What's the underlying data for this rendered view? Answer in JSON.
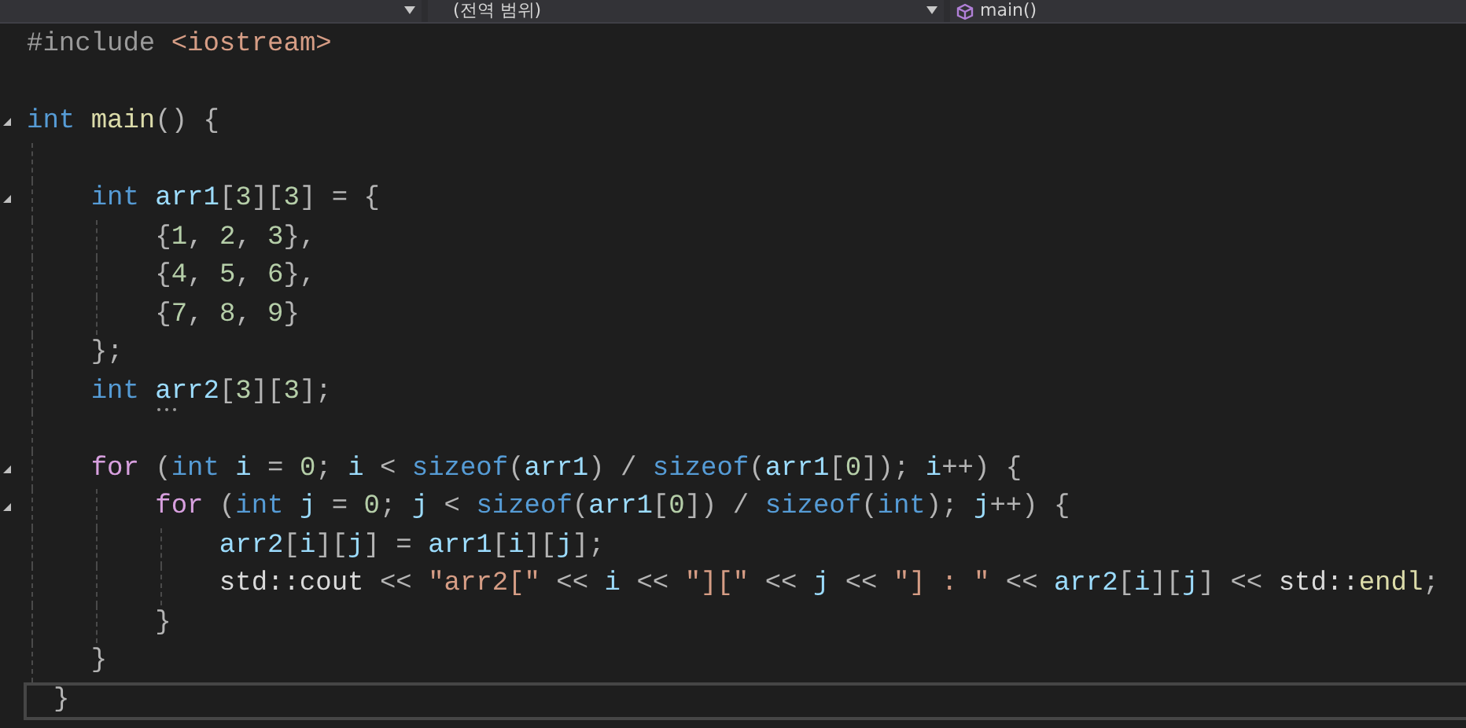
{
  "navigation_bar": {
    "dropdowns": [
      {
        "kind": "plain"
      },
      {
        "kind": "scope",
        "label": "(전역 범위)"
      },
      {
        "kind": "member",
        "label": "main()"
      }
    ]
  },
  "editor": {
    "lines": [
      {
        "kind": "code",
        "current": false,
        "tokens": [
          {
            "kind": "pre",
            "text": "#include "
          },
          {
            "kind": "str",
            "text": "<iostream>"
          }
        ]
      },
      {
        "kind": "blank"
      },
      {
        "kind": "code",
        "current": false,
        "expanded": true,
        "tokens": [
          {
            "kind": "type",
            "text": "int "
          },
          {
            "kind": "func",
            "text": "main"
          },
          {
            "kind": "punct",
            "text": "() {"
          }
        ]
      },
      {
        "kind": "blank"
      },
      {
        "kind": "code",
        "current": false,
        "expanded": true,
        "tokens": [
          {
            "kind": "type",
            "text": "    int "
          },
          {
            "kind": "var",
            "text": "arr1"
          },
          {
            "kind": "punct",
            "text": "["
          },
          {
            "kind": "num",
            "text": "3"
          },
          {
            "kind": "punct",
            "text": "]["
          },
          {
            "kind": "num",
            "text": "3"
          },
          {
            "kind": "punct",
            "text": "] = {"
          }
        ]
      },
      {
        "kind": "code",
        "current": false,
        "tokens": [
          {
            "kind": "punct",
            "text": "        {"
          },
          {
            "kind": "num",
            "text": "1"
          },
          {
            "kind": "punct",
            "text": ", "
          },
          {
            "kind": "num",
            "text": "2"
          },
          {
            "kind": "punct",
            "text": ", "
          },
          {
            "kind": "num",
            "text": "3"
          },
          {
            "kind": "punct",
            "text": "},"
          }
        ]
      },
      {
        "kind": "code",
        "current": false,
        "tokens": [
          {
            "kind": "punct",
            "text": "        {"
          },
          {
            "kind": "num",
            "text": "4"
          },
          {
            "kind": "punct",
            "text": ", "
          },
          {
            "kind": "num",
            "text": "5"
          },
          {
            "kind": "punct",
            "text": ", "
          },
          {
            "kind": "num",
            "text": "6"
          },
          {
            "kind": "punct",
            "text": "},"
          }
        ]
      },
      {
        "kind": "code",
        "current": false,
        "tokens": [
          {
            "kind": "punct",
            "text": "        {"
          },
          {
            "kind": "num",
            "text": "7"
          },
          {
            "kind": "punct",
            "text": ", "
          },
          {
            "kind": "num",
            "text": "8"
          },
          {
            "kind": "punct",
            "text": ", "
          },
          {
            "kind": "num",
            "text": "9"
          },
          {
            "kind": "punct",
            "text": "}"
          }
        ]
      },
      {
        "kind": "code",
        "current": false,
        "tokens": [
          {
            "kind": "punct",
            "text": "    };"
          }
        ]
      },
      {
        "kind": "code",
        "current": false,
        "suggestion": true,
        "tokens": [
          {
            "kind": "type",
            "text": "    int "
          },
          {
            "kind": "var",
            "text": "arr2"
          },
          {
            "kind": "punct",
            "text": "["
          },
          {
            "kind": "num",
            "text": "3"
          },
          {
            "kind": "punct",
            "text": "]["
          },
          {
            "kind": "num",
            "text": "3"
          },
          {
            "kind": "punct",
            "text": "];"
          }
        ]
      },
      {
        "kind": "blank"
      },
      {
        "kind": "code",
        "current": false,
        "expanded": true,
        "tokens": [
          {
            "kind": "kw",
            "text": "    for"
          },
          {
            "kind": "punct",
            "text": " ("
          },
          {
            "kind": "type",
            "text": "int "
          },
          {
            "kind": "var",
            "text": "i"
          },
          {
            "kind": "punct",
            "text": " = "
          },
          {
            "kind": "num",
            "text": "0"
          },
          {
            "kind": "punct",
            "text": "; "
          },
          {
            "kind": "var",
            "text": "i"
          },
          {
            "kind": "punct",
            "text": " < "
          },
          {
            "kind": "type",
            "text": "sizeof"
          },
          {
            "kind": "punct",
            "text": "("
          },
          {
            "kind": "var",
            "text": "arr1"
          },
          {
            "kind": "punct",
            "text": ") / "
          },
          {
            "kind": "type",
            "text": "sizeof"
          },
          {
            "kind": "punct",
            "text": "("
          },
          {
            "kind": "var",
            "text": "arr1"
          },
          {
            "kind": "punct",
            "text": "["
          },
          {
            "kind": "num",
            "text": "0"
          },
          {
            "kind": "punct",
            "text": "]); "
          },
          {
            "kind": "var",
            "text": "i"
          },
          {
            "kind": "punct",
            "text": "++) {"
          }
        ]
      },
      {
        "kind": "code",
        "current": false,
        "expanded": true,
        "tokens": [
          {
            "kind": "kw",
            "text": "        for"
          },
          {
            "kind": "punct",
            "text": " ("
          },
          {
            "kind": "type",
            "text": "int "
          },
          {
            "kind": "var",
            "text": "j"
          },
          {
            "kind": "punct",
            "text": " = "
          },
          {
            "kind": "num",
            "text": "0"
          },
          {
            "kind": "punct",
            "text": "; "
          },
          {
            "kind": "var",
            "text": "j"
          },
          {
            "kind": "punct",
            "text": " < "
          },
          {
            "kind": "type",
            "text": "sizeof"
          },
          {
            "kind": "punct",
            "text": "("
          },
          {
            "kind": "var",
            "text": "arr1"
          },
          {
            "kind": "punct",
            "text": "["
          },
          {
            "kind": "num",
            "text": "0"
          },
          {
            "kind": "punct",
            "text": "]) / "
          },
          {
            "kind": "type",
            "text": "sizeof"
          },
          {
            "kind": "punct",
            "text": "("
          },
          {
            "kind": "type",
            "text": "int"
          },
          {
            "kind": "punct",
            "text": "); "
          },
          {
            "kind": "var",
            "text": "j"
          },
          {
            "kind": "punct",
            "text": "++) {"
          }
        ]
      },
      {
        "kind": "code",
        "current": false,
        "tokens": [
          {
            "kind": "var",
            "text": "            arr2"
          },
          {
            "kind": "punct",
            "text": "["
          },
          {
            "kind": "var",
            "text": "i"
          },
          {
            "kind": "punct",
            "text": "]["
          },
          {
            "kind": "var",
            "text": "j"
          },
          {
            "kind": "punct",
            "text": "] = "
          },
          {
            "kind": "var",
            "text": "arr1"
          },
          {
            "kind": "punct",
            "text": "["
          },
          {
            "kind": "var",
            "text": "i"
          },
          {
            "kind": "punct",
            "text": "]["
          },
          {
            "kind": "var",
            "text": "j"
          },
          {
            "kind": "punct",
            "text": "];"
          }
        ]
      },
      {
        "kind": "code",
        "current": false,
        "tokens": [
          {
            "kind": "plain",
            "text": "            std::cout"
          },
          {
            "kind": "punct",
            "text": " << "
          },
          {
            "kind": "str",
            "text": "\"arr2[\""
          },
          {
            "kind": "punct",
            "text": " << "
          },
          {
            "kind": "var",
            "text": "i"
          },
          {
            "kind": "punct",
            "text": " << "
          },
          {
            "kind": "str",
            "text": "\"][\""
          },
          {
            "kind": "punct",
            "text": " << "
          },
          {
            "kind": "var",
            "text": "j"
          },
          {
            "kind": "punct",
            "text": " << "
          },
          {
            "kind": "str",
            "text": "\"] : \""
          },
          {
            "kind": "punct",
            "text": " << "
          },
          {
            "kind": "var",
            "text": "arr2"
          },
          {
            "kind": "punct",
            "text": "["
          },
          {
            "kind": "var",
            "text": "i"
          },
          {
            "kind": "punct",
            "text": "]["
          },
          {
            "kind": "var",
            "text": "j"
          },
          {
            "kind": "punct",
            "text": "] << "
          },
          {
            "kind": "plain",
            "text": "std::"
          },
          {
            "kind": "func",
            "text": "endl"
          },
          {
            "kind": "punct",
            "text": ";"
          }
        ]
      },
      {
        "kind": "code",
        "current": false,
        "tokens": [
          {
            "kind": "punct",
            "text": "        }"
          }
        ]
      },
      {
        "kind": "code",
        "current": false,
        "tokens": [
          {
            "kind": "punct",
            "text": "    }"
          }
        ]
      },
      {
        "kind": "code",
        "current": true,
        "tokens": [
          {
            "kind": "punct",
            "text": "}"
          }
        ]
      }
    ]
  }
}
